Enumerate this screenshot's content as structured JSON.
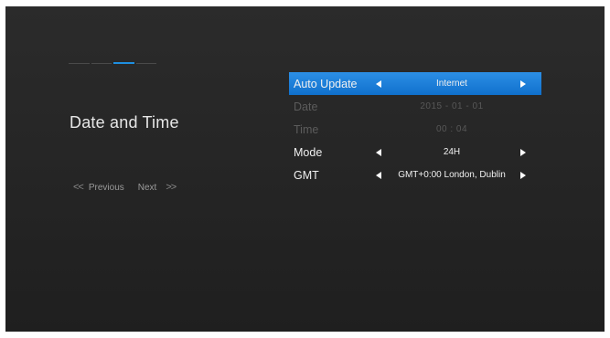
{
  "progress": {
    "segments": 4,
    "active_index": 2,
    "accent_color": "#1e8fe0"
  },
  "page": {
    "title": "Date and Time"
  },
  "nav": {
    "prev_icon": "<<",
    "prev_label": "Previous",
    "next_label": "Next",
    "next_icon": ">>"
  },
  "settings": {
    "rows": [
      {
        "label": "Auto Update",
        "value": "Internet",
        "state": "selected"
      },
      {
        "label": "Date",
        "value": "2015 - 01 - 01",
        "state": "disabled"
      },
      {
        "label": "Time",
        "value": "00 : 04",
        "state": "disabled"
      },
      {
        "label": "Mode",
        "value": "24H",
        "state": "normal"
      },
      {
        "label": "GMT",
        "value": "GMT+0:00 London, Dublin",
        "state": "normal"
      }
    ]
  },
  "icons": {
    "left": "triangle-left-icon",
    "right": "triangle-right-icon"
  }
}
